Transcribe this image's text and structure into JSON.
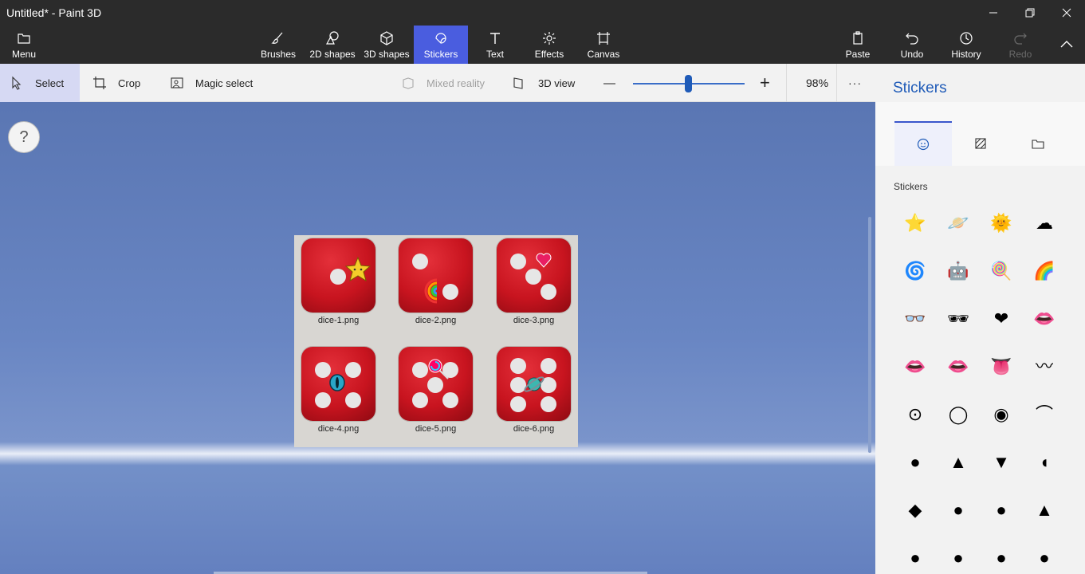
{
  "window": {
    "title": "Untitled* - Paint 3D",
    "minimize_icon": "minimize-icon",
    "restore_icon": "restore-icon",
    "close_icon": "close-icon"
  },
  "ribbon": {
    "menu": "Menu",
    "tools": [
      {
        "label": "Brushes",
        "icon": "brush-icon"
      },
      {
        "label": "2D shapes",
        "icon": "2d-shapes-icon"
      },
      {
        "label": "3D shapes",
        "icon": "3d-shapes-icon"
      },
      {
        "label": "Stickers",
        "icon": "stickers-icon",
        "active": true
      },
      {
        "label": "Text",
        "icon": "text-icon"
      },
      {
        "label": "Effects",
        "icon": "effects-icon"
      },
      {
        "label": "Canvas",
        "icon": "canvas-icon"
      }
    ],
    "paste": "Paste",
    "undo": "Undo",
    "history": "History",
    "redo": "Redo"
  },
  "toolbar": {
    "select": "Select",
    "crop": "Crop",
    "magic_select": "Magic select",
    "mixed_reality": "Mixed reality",
    "view_3d": "3D view",
    "zoom_minus": "—",
    "zoom_plus": "+",
    "zoom_level": "98%",
    "zoom_fraction": 0.49,
    "more": "···"
  },
  "help": "?",
  "canvas": {
    "dice": [
      {
        "label": "dice-1.png",
        "pips": 1,
        "sticker": "star"
      },
      {
        "label": "dice-2.png",
        "pips": 2,
        "sticker": "rainbow"
      },
      {
        "label": "dice-3.png",
        "pips": 3,
        "sticker": "heart"
      },
      {
        "label": "dice-4.png",
        "pips": 4,
        "sticker": "cat-eye"
      },
      {
        "label": "dice-5.png",
        "pips": 5,
        "sticker": "lollipop"
      },
      {
        "label": "dice-6.png",
        "pips": 6,
        "sticker": "planet"
      }
    ]
  },
  "panel": {
    "title": "Stickers",
    "tabs": [
      "stickers-tab-icon",
      "textures-tab-icon",
      "custom-sticker-folder-icon"
    ],
    "section_heading": "Stickers",
    "stickers": [
      "⭐",
      "🪐",
      "🌞",
      "☁",
      "🌀",
      "🤖",
      "🍭",
      "🌈",
      "👓",
      "🕶",
      "❤",
      "👄",
      "👄",
      "👄",
      "👅",
      "〰",
      "⊙",
      "◯",
      "◉",
      "⌒",
      "●",
      "▲",
      "▼",
      "◖",
      "◆",
      "●",
      "●",
      "▲",
      "●",
      "●",
      "●",
      "●"
    ]
  },
  "colors": {
    "accent": "#4a5ddf",
    "title_blue": "#1f5bb8",
    "die_red": "#c8141f"
  }
}
